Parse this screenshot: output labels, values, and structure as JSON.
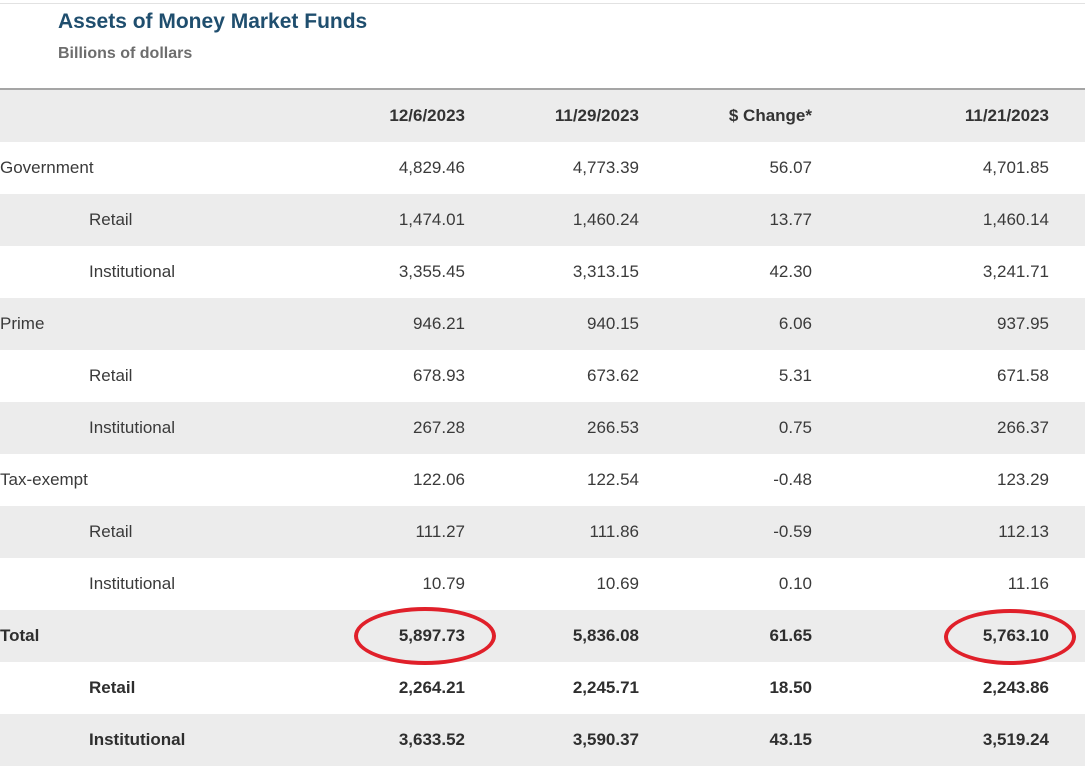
{
  "title": "Assets of Money Market Funds",
  "subtitle": "Billions of dollars",
  "columns": [
    "",
    "12/6/2023",
    "11/29/2023",
    "$ Change*",
    "11/21/2023"
  ],
  "rows": [
    {
      "label": "Government",
      "level": 0,
      "bold": false,
      "values": [
        "4,829.46",
        "4,773.39",
        "56.07",
        "4,701.85"
      ]
    },
    {
      "label": "Retail",
      "level": 1,
      "bold": false,
      "values": [
        "1,474.01",
        "1,460.24",
        "13.77",
        "1,460.14"
      ]
    },
    {
      "label": "Institutional",
      "level": 1,
      "bold": false,
      "values": [
        "3,355.45",
        "3,313.15",
        "42.30",
        "3,241.71"
      ]
    },
    {
      "label": "Prime",
      "level": 0,
      "bold": false,
      "values": [
        "946.21",
        "940.15",
        "6.06",
        "937.95"
      ]
    },
    {
      "label": "Retail",
      "level": 1,
      "bold": false,
      "values": [
        "678.93",
        "673.62",
        "5.31",
        "671.58"
      ]
    },
    {
      "label": "Institutional",
      "level": 1,
      "bold": false,
      "values": [
        "267.28",
        "266.53",
        "0.75",
        "266.37"
      ]
    },
    {
      "label": "Tax-exempt",
      "level": 0,
      "bold": false,
      "values": [
        "122.06",
        "122.54",
        "-0.48",
        "123.29"
      ]
    },
    {
      "label": "Retail",
      "level": 1,
      "bold": false,
      "values": [
        "111.27",
        "111.86",
        "-0.59",
        "112.13"
      ]
    },
    {
      "label": "Institutional",
      "level": 1,
      "bold": false,
      "values": [
        "10.79",
        "10.69",
        "0.10",
        "11.16"
      ]
    },
    {
      "label": "Total",
      "level": 0,
      "bold": true,
      "values": [
        "5,897.73",
        "5,836.08",
        "61.65",
        "5,763.10"
      ]
    },
    {
      "label": "Retail",
      "level": 1,
      "bold": true,
      "values": [
        "2,264.21",
        "2,245.71",
        "18.50",
        "2,243.86"
      ]
    },
    {
      "label": "Institutional",
      "level": 1,
      "bold": true,
      "values": [
        "3,633.52",
        "3,590.37",
        "43.15",
        "3,519.24"
      ]
    }
  ],
  "highlight_color": "#e0202a",
  "title_color": "#1f4e6e"
}
